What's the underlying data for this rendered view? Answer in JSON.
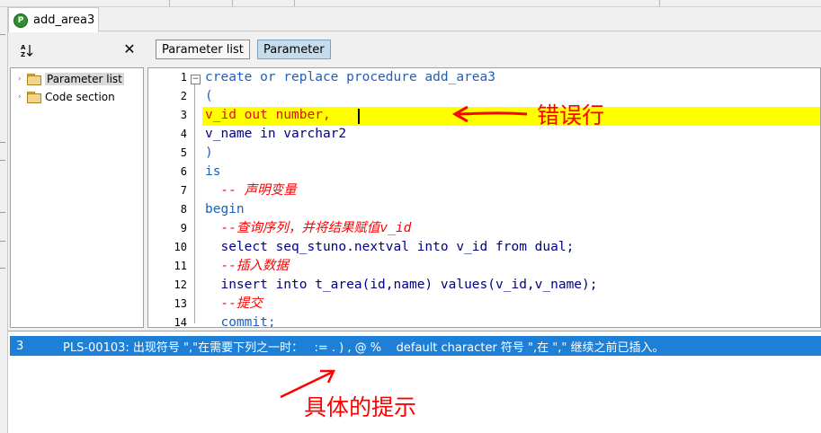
{
  "tab": {
    "title": "add_area3",
    "icon": "plsql-procedure-icon"
  },
  "left_panel": {
    "sort_icon": "sort-az-icon",
    "close_glyph": "✕",
    "tree": [
      {
        "label": "Parameter list",
        "selected": true
      },
      {
        "label": "Code section",
        "selected": false
      }
    ]
  },
  "editor_tabs": [
    {
      "label": "Parameter list",
      "active": false
    },
    {
      "label": "Parameter",
      "active": true
    }
  ],
  "code": {
    "line_numbers": [
      "1",
      "2",
      "3",
      "4",
      "5",
      "6",
      "7",
      "8",
      "9",
      "10",
      "11",
      "12",
      "13",
      "14"
    ],
    "lines": [
      "create or replace procedure add_area3",
      "(",
      "v_id out number,",
      "v_name in varchar2",
      ")",
      "is",
      "  -- 声明变量",
      "begin",
      "  --查询序列，并将结果赋值v_id",
      "  select seq_stuno.nextval into v_id from dual;",
      "  --插入数据",
      "  insert into t_area(id,name) values(v_id,v_name);",
      "  --提交",
      "  commit;"
    ],
    "highlighted_line": "3"
  },
  "annotations": {
    "error_line_label": "错误行",
    "hint_label": "具体的提示"
  },
  "messages": [
    {
      "line": "3",
      "text": "PLS-00103: 出现符号 \",\"在需要下列之一时：   := . ) , @ %    default character 符号 \",在 \",\" 继续之前已插入。"
    }
  ],
  "colors": {
    "highlight": "#ffff00",
    "selection": "#1e7fd6",
    "keyword": "#1d5fbd",
    "comment": "#ff0000",
    "annotation": "#ff0000"
  }
}
